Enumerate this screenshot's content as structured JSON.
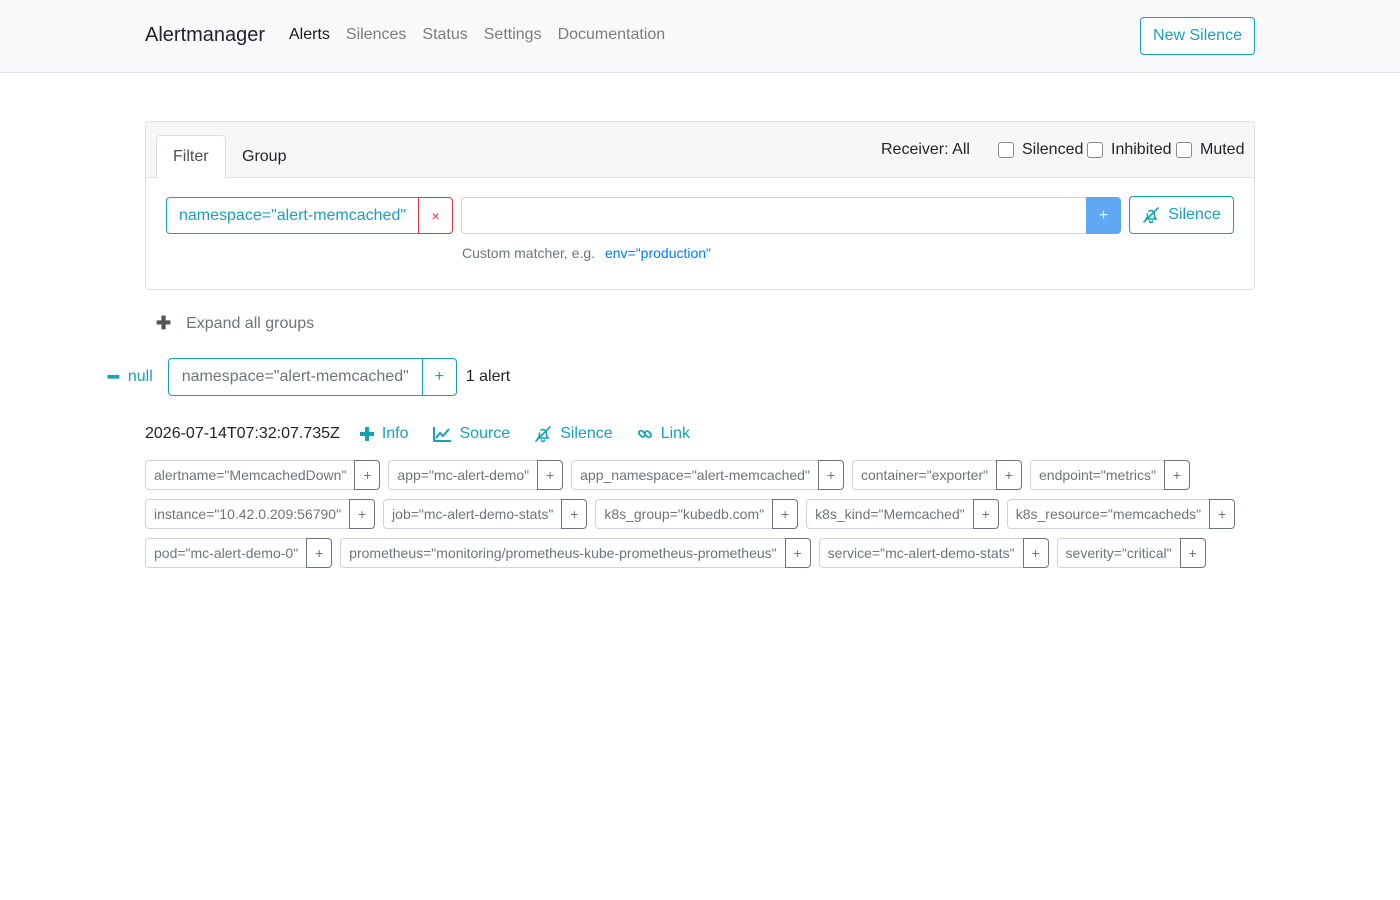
{
  "navbar": {
    "brand": "Alertmanager",
    "links": [
      {
        "label": "Alerts",
        "active": true
      },
      {
        "label": "Silences",
        "active": false
      },
      {
        "label": "Status",
        "active": false
      },
      {
        "label": "Settings",
        "active": false
      },
      {
        "label": "Documentation",
        "active": false
      }
    ],
    "new_silence_label": "New Silence"
  },
  "filter": {
    "tabs": [
      "Filter",
      "Group"
    ],
    "active_tab": "Filter",
    "receiver_label": "Receiver: All",
    "checkboxes": [
      {
        "label": "Silenced",
        "checked": false
      },
      {
        "label": "Inhibited",
        "checked": false
      },
      {
        "label": "Muted",
        "checked": false
      }
    ],
    "matcher": "namespace=\"alert-memcached\"",
    "remove_symbol": "×",
    "input_value": "",
    "input_placeholder": "",
    "add_symbol": "+",
    "silence_label": "Silence",
    "hint_prefix": "Custom matcher, e.g.",
    "hint_example": "env=\"production\""
  },
  "groups": {
    "expand_all_label": "Expand all groups",
    "expand_symbol": "✚",
    "items": [
      {
        "receiver": "null",
        "collapse_symbol": "━",
        "matcher": "namespace=\"alert-memcached\"",
        "add_symbol": "+",
        "count_label": "1 alert",
        "alert": {
          "timestamp": "2026-07-14T07:32:07.735Z",
          "actions": {
            "info": "Info",
            "source": "Source",
            "silence": "Silence",
            "link": "Link"
          },
          "label_rows": [
            [
              "alertname=\"MemcachedDown\"",
              "app=\"mc-alert-demo\"",
              "app_namespace=\"alert-memcached\"",
              "container=\"exporter\"",
              "endpoint=\"metrics\""
            ],
            [
              "instance=\"10.42.0.209:56790\"",
              "job=\"mc-alert-demo-stats\"",
              "k8s_group=\"kubedb.com\"",
              "k8s_kind=\"Memcached\"",
              "k8s_resource=\"memcacheds\""
            ],
            [
              "pod=\"mc-alert-demo-0\"",
              "prometheus=\"monitoring/prometheus-kube-prometheus-prometheus\"",
              "service=\"mc-alert-demo-stats\"",
              "severity=\"critical\""
            ]
          ]
        }
      }
    ]
  },
  "colors": {
    "accent": "#17a2b8",
    "danger": "#dc3545",
    "primary_button": "#5fa8f5",
    "link": "#007bff"
  }
}
